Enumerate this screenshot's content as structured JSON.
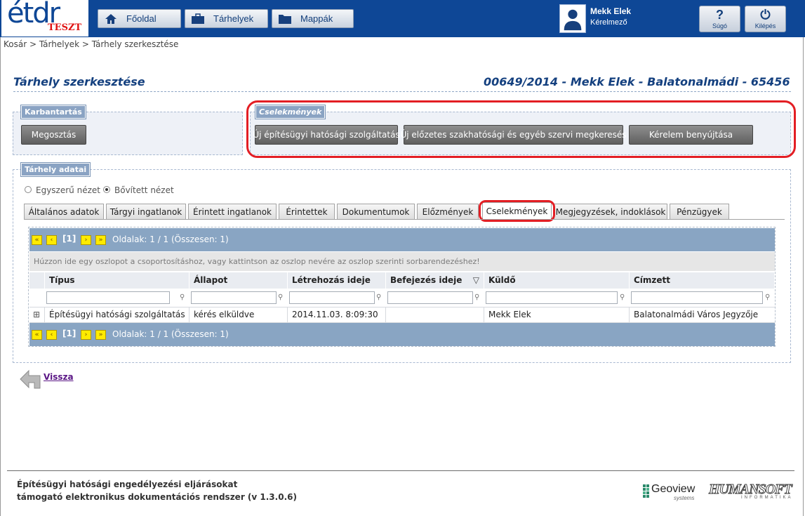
{
  "header": {
    "logo_text": "étdr",
    "logo_badge": "TESZT",
    "nav": [
      {
        "label": "Főoldal",
        "icon": "home-icon"
      },
      {
        "label": "Tárhelyek",
        "icon": "briefcase-icon"
      },
      {
        "label": "Mappák",
        "icon": "folder-icon"
      }
    ],
    "user": {
      "name": "Mekk Elek",
      "role": "Kérelmező"
    },
    "help_label": "Súgó",
    "logout_label": "Kilépés"
  },
  "breadcrumb": "Kosár > Tárhelyek > Tárhely szerkesztése",
  "page": {
    "title": "Tárhely szerkesztése",
    "subtitle": "00649/2014 - Mekk Elek - Balatonalmádi - 65456"
  },
  "karbantartas": {
    "legend": "Karbantartás",
    "share_button": "Megosztás"
  },
  "cselekmenyek": {
    "legend": "Cselekmények",
    "buttons": [
      "Új építésügyi hatósági szolgáltatás",
      "Új előzetes szakhatósági és egyéb szervi megkeresés",
      "Kérelem benyújtása"
    ]
  },
  "tarhely_adatai": {
    "legend": "Tárhely adatai",
    "view_simple": "Egyszerű nézet",
    "view_extended": "Bővített nézet",
    "selected_view": "Bővített nézet"
  },
  "tabs": [
    "Általános adatok",
    "Tárgyi ingatlanok",
    "Érintett ingatlanok",
    "Érintettek",
    "Dokumentumok",
    "Előzmények",
    "Cselekmények",
    "Megjegyzések, indoklások",
    "Pénzügyek"
  ],
  "active_tab": "Cselekmények",
  "pager": {
    "first": "«",
    "prev": "‹",
    "current": "[1]",
    "next": "›",
    "last": "»",
    "info": "Oldalak: 1 / 1 (Összesen: 1)"
  },
  "grid": {
    "group_hint": "Húzzon ide egy oszlopot a csoportosításhoz, vagy kattintson az oszlop nevére az oszlop szerinti sorbarendezéshez!",
    "columns": [
      "Típus",
      "Állapot",
      "Létrehozás ideje",
      "Befejezés ideje",
      "Küldő",
      "Címzett"
    ],
    "sort_glyph": "▽",
    "rows": [
      {
        "expand": "⊞",
        "cells": [
          "Építésügyi hatósági szolgáltatás",
          "kérés elküldve",
          "2014.11.03. 8:09:30",
          "",
          "Mekk Elek",
          "Balatonalmádi Város Jegyzője"
        ]
      }
    ]
  },
  "back_label": "Vissza",
  "footer": {
    "line1": "Építésügyi hatósági engedélyezési eljárásokat",
    "line2": "támogató elektronikus dokumentációs rendszer (v 1.3.0.6)",
    "geoview": "Geoview",
    "geoview_sub": "systems",
    "humansoft": "HUMANSOFT",
    "humansoft_sub": "INFORMATIKA"
  },
  "colors": {
    "header_bg": "#0e4796",
    "title": "#14407f",
    "highlight": "#e31e24",
    "legend_bg": "#8aa3c3",
    "pager_yellow": "#ffeb00"
  }
}
